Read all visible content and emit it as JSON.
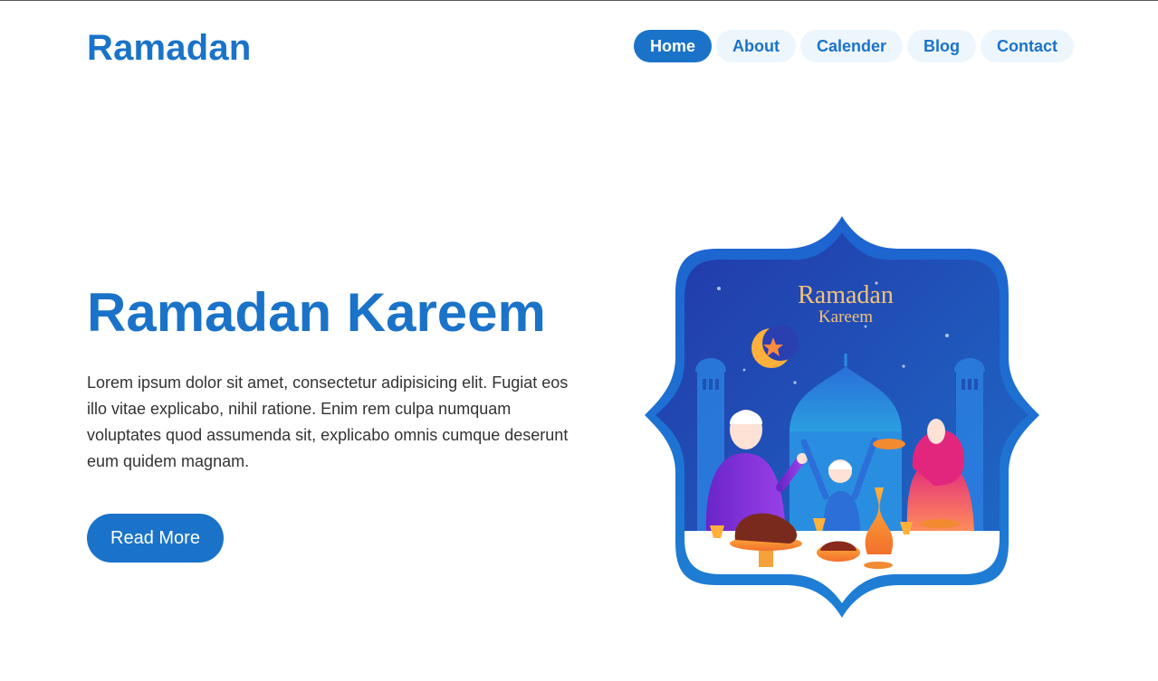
{
  "brand": {
    "name": "Ramadan"
  },
  "nav": {
    "items": [
      {
        "label": "Home",
        "active": true
      },
      {
        "label": "About",
        "active": false
      },
      {
        "label": "Calender",
        "active": false
      },
      {
        "label": "Blog",
        "active": false
      },
      {
        "label": "Contact",
        "active": false
      }
    ]
  },
  "hero": {
    "title": "Ramadan Kareem",
    "text": "Lorem ipsum dolor sit amet, consectetur adipisicing elit. Fugiat eos illo vitae explicabo, nihil ratione. Enim rem culpa numquam voluptates quod assumenda sit, explicabo omnis cumque deserunt eum quidem magnam.",
    "button_label": "Read More"
  },
  "illustration": {
    "title_line1": "Ramadan",
    "title_line2": "Kareem"
  },
  "colors": {
    "accent": "#1a73c8",
    "pill_bg": "#eef6fd",
    "text": "#333333"
  }
}
